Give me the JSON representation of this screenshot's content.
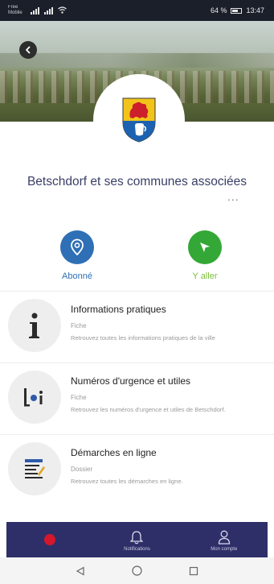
{
  "status_bar": {
    "carrier": "Free Mobile",
    "battery": "64 %",
    "time": "13:47"
  },
  "header": {
    "back_icon": "back-arrow-icon"
  },
  "commune": {
    "name": "Betschdorf et ses communes associées",
    "crest_colors": {
      "top": "#f2c419",
      "lion": "#cc1f2b",
      "bottom": "#1d62b0",
      "jug": "#ffffff"
    }
  },
  "actions": {
    "subscribe": {
      "label": "Abonné",
      "icon": "location-pin-icon",
      "color": "#2f6fb5"
    },
    "go": {
      "label": "Y aller",
      "icon": "navigation-arrow-icon",
      "color": "#34a836"
    }
  },
  "list": [
    {
      "title": "Informations pratiques",
      "kind": "Fiche",
      "description": "Retrouvez toutes les informations pratiques de la ville",
      "icon": "info-icon"
    },
    {
      "title": "Numéros d'urgence et utiles",
      "kind": "Fiche",
      "description": "Retrouvez les numéros d'urgence et utiles de Betschdorf.",
      "icon": "phone-info-icon"
    },
    {
      "title": "Démarches en ligne",
      "kind": "Dossier",
      "description": "Retrouvez toutes les démarches en ligne.",
      "icon": "form-icon"
    }
  ],
  "tabbar": {
    "home": {
      "label": "",
      "icon": "home-dot-icon"
    },
    "notifications": {
      "label": "Notifications",
      "icon": "bell-icon"
    },
    "account": {
      "label": "Mon compte",
      "icon": "user-icon"
    }
  },
  "navbar": {
    "back": "back-triangle-icon",
    "home": "home-circle-icon",
    "recent": "recent-square-icon"
  },
  "colors": {
    "accent": "#2e2f68",
    "title": "#3a3f66"
  }
}
